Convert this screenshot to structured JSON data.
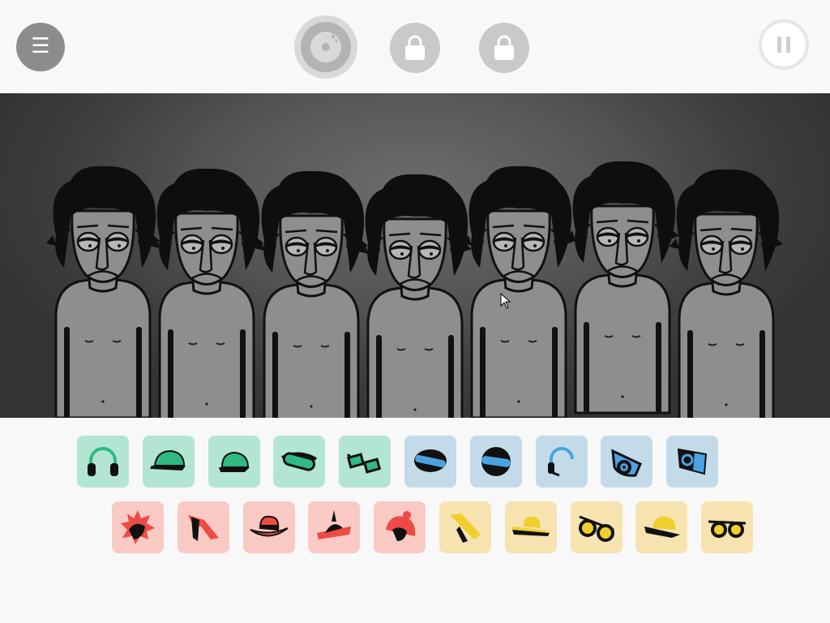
{
  "topbar": {
    "menu_glyph": "☰",
    "menu_icon": "hamburger-menu-icon",
    "bonus_icon": "vinyl-disc-icon",
    "lock_icons": [
      "padlock-icon",
      "padlock-icon"
    ],
    "pause_icon": "pause-icon"
  },
  "stage": {
    "performer_count": 7,
    "performer_state": "idle"
  },
  "palette": {
    "green_bg": "#b3e6d2",
    "green_fg": "#2fba84",
    "blue_bg": "#c3dbe8",
    "blue_fg": "#4aa3e0",
    "red_bg": "#f9c9c4",
    "red_fg": "#ee4b44",
    "yellow_bg": "#f7e3b0",
    "yellow_fg": "#f0cf2c"
  },
  "sound_icons": {
    "row1": [
      {
        "name": "headphones-icon",
        "color": "green"
      },
      {
        "name": "cap-icon",
        "color": "green"
      },
      {
        "name": "cap-side-icon",
        "color": "green"
      },
      {
        "name": "ski-goggles-icon",
        "color": "green"
      },
      {
        "name": "3d-glasses-icon",
        "color": "green"
      },
      {
        "name": "visor-icon",
        "color": "blue"
      },
      {
        "name": "helmet-visor-icon",
        "color": "blue"
      },
      {
        "name": "headset-icon",
        "color": "blue"
      },
      {
        "name": "headband-speaker-icon",
        "color": "blue"
      },
      {
        "name": "speaker-box-icon",
        "color": "blue"
      }
    ],
    "row2": [
      {
        "name": "spiky-hat-icon",
        "color": "red"
      },
      {
        "name": "tie-icon",
        "color": "red"
      },
      {
        "name": "fedora-icon",
        "color": "red"
      },
      {
        "name": "propeller-hat-icon",
        "color": "red"
      },
      {
        "name": "beanie-icon",
        "color": "red"
      },
      {
        "name": "scarf-icon",
        "color": "yellow"
      },
      {
        "name": "straw-hat-icon",
        "color": "yellow"
      },
      {
        "name": "sunglasses-icon",
        "color": "yellow"
      },
      {
        "name": "bowler-hat-icon",
        "color": "yellow"
      },
      {
        "name": "round-sunglasses-icon",
        "color": "yellow"
      }
    ]
  }
}
